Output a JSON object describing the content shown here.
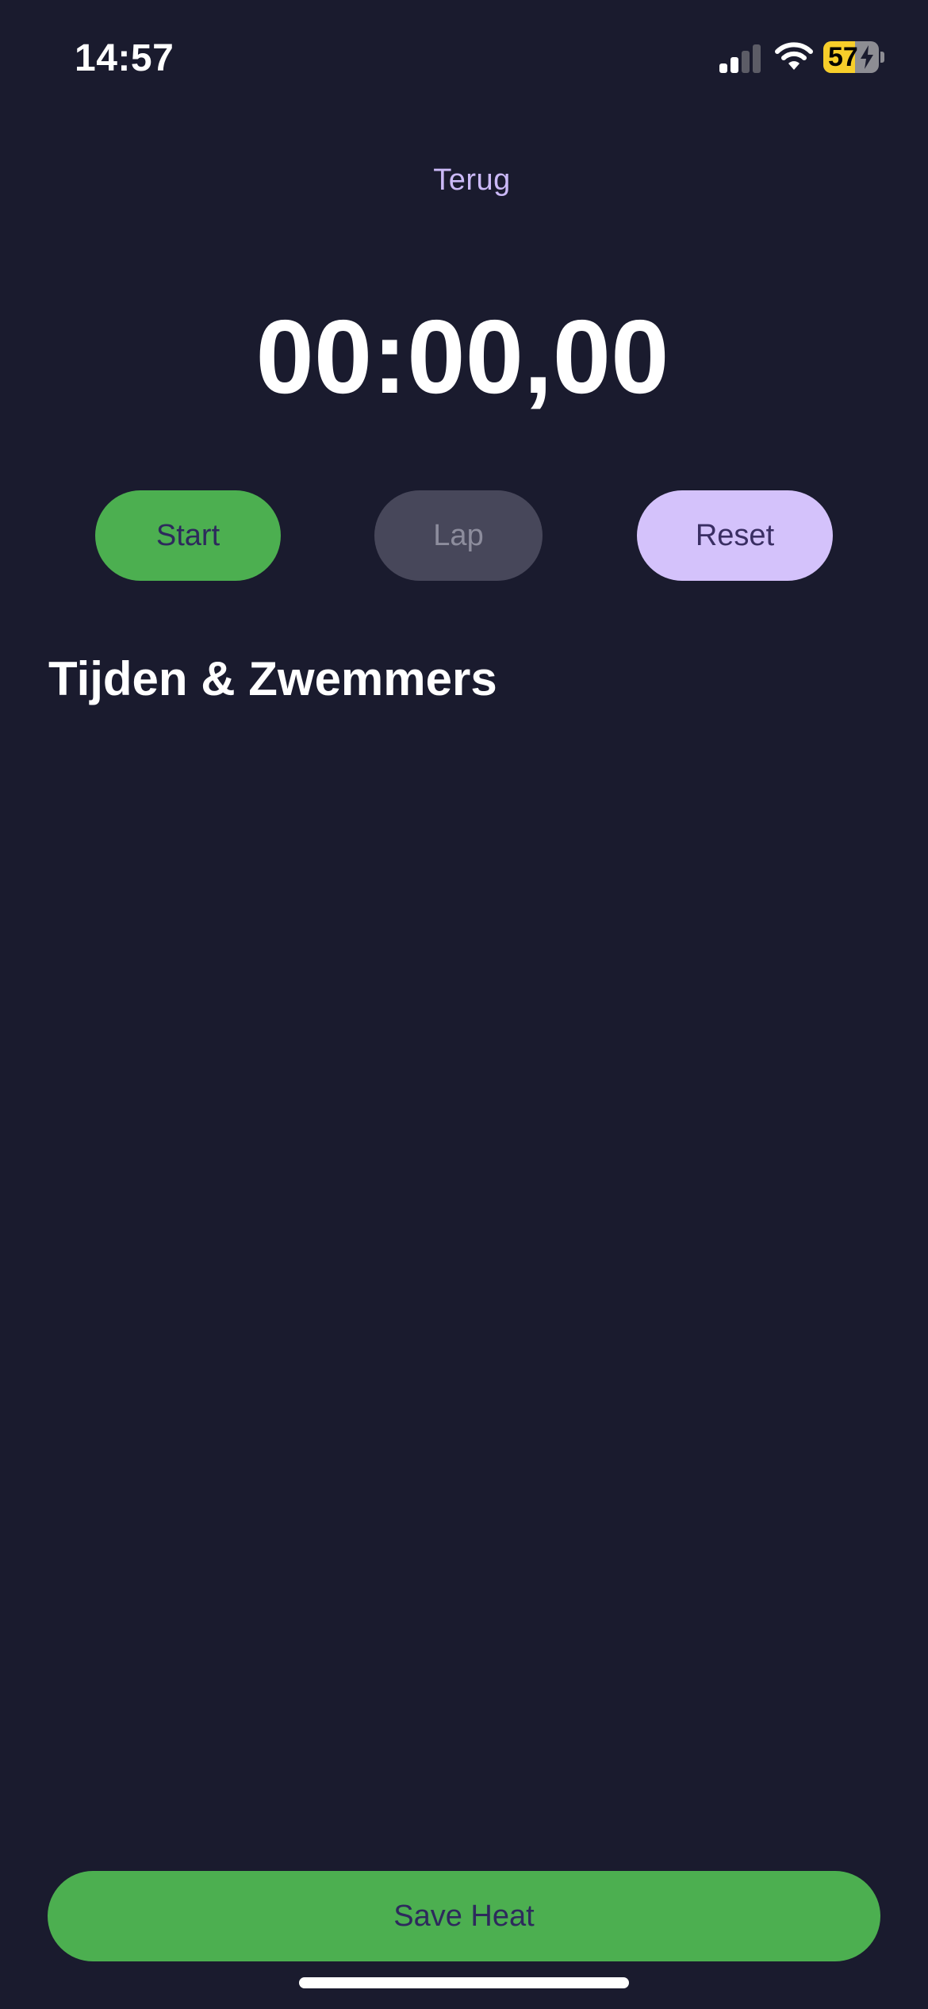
{
  "status_bar": {
    "time": "14:57",
    "battery_level": "57",
    "battery_fraction": 0.57,
    "battery_color": "#f7ce2a",
    "icons": [
      "signal-icon",
      "wifi-icon",
      "battery-icon",
      "charging-bolt-icon"
    ]
  },
  "nav": {
    "back_label": "Terug"
  },
  "stopwatch": {
    "time": "00:00,00"
  },
  "controls": {
    "start_label": "Start",
    "lap_label": "Lap",
    "reset_label": "Reset"
  },
  "results": {
    "title": "Tijden & Zwemmers"
  },
  "footer": {
    "save_label": "Save Heat"
  },
  "colors": {
    "background": "#1a1b2e",
    "accent_green": "#4caf50",
    "accent_lavender": "#d4c2fb",
    "disabled_gray": "#47475a"
  }
}
